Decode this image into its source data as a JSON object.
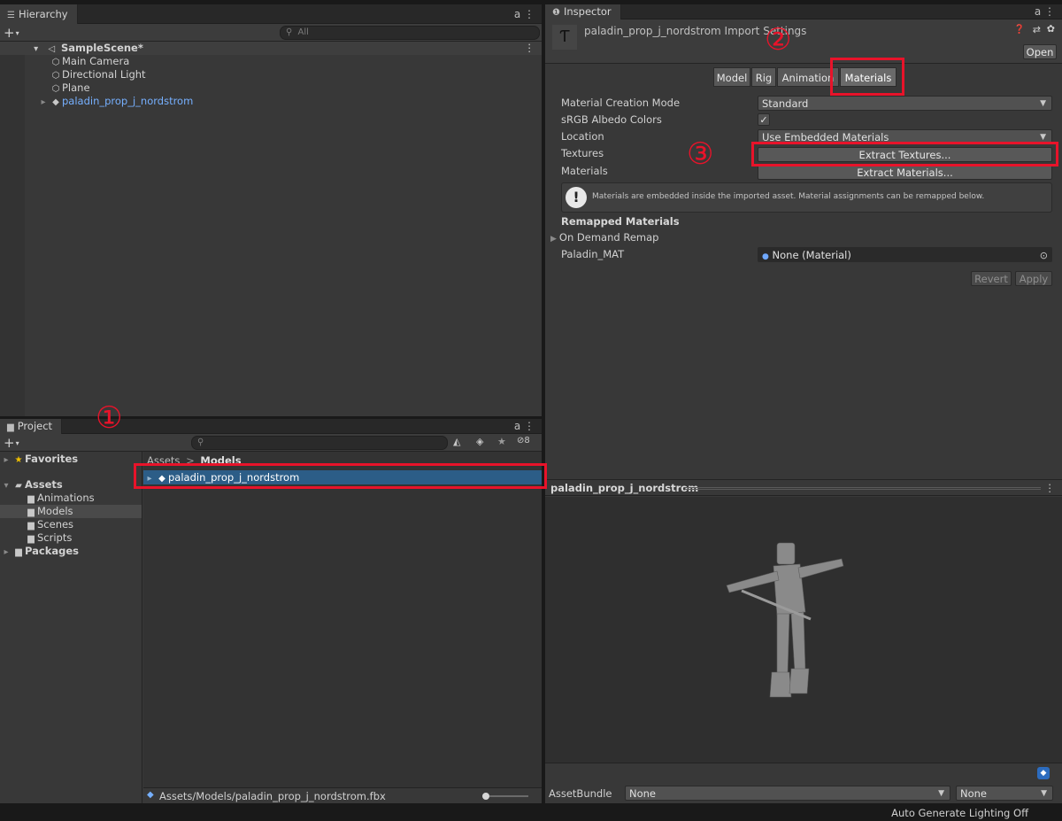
{
  "hierarchy": {
    "tab_label": "Hierarchy",
    "tab_controls": "a ⋮",
    "search_placeholder": "All",
    "scene_name": "SampleScene*",
    "items": [
      {
        "label": "Main Camera"
      },
      {
        "label": "Directional Light"
      },
      {
        "label": "Plane"
      },
      {
        "label": "paladin_prop_j_nordstrom"
      }
    ]
  },
  "project": {
    "tab_label": "Project",
    "tab_controls": "a ⋮",
    "hidden_count": "8",
    "tree": {
      "favorites": "Favorites",
      "assets": "Assets",
      "folders": [
        {
          "label": "Animations"
        },
        {
          "label": "Models"
        },
        {
          "label": "Scenes"
        },
        {
          "label": "Scripts"
        }
      ],
      "packages": "Packages"
    },
    "breadcrumb": {
      "root": "Assets",
      "separator": ">",
      "current": "Models"
    },
    "selected_asset": "paladin_prop_j_nordstrom",
    "footer_path": "Assets/Models/paladin_prop_j_nordstrom.fbx"
  },
  "inspector": {
    "tab_label": "Inspector",
    "tab_controls": "a ⋮",
    "title": "paladin_prop_j_nordstrom Import Settings",
    "open_label": "Open",
    "tabs": [
      {
        "label": "Model"
      },
      {
        "label": "Rig"
      },
      {
        "label": "Animation"
      },
      {
        "label": "Materials"
      }
    ],
    "active_tab": "Materials",
    "fields": {
      "material_creation_mode": {
        "label": "Material Creation Mode",
        "value": "Standard"
      },
      "srgb": {
        "label": "sRGB Albedo Colors",
        "checked": true
      },
      "location": {
        "label": "Location",
        "value": "Use Embedded Materials"
      },
      "textures": {
        "label": "Textures",
        "button": "Extract Textures..."
      },
      "materials": {
        "label": "Materials",
        "button": "Extract Materials..."
      }
    },
    "info_message": "Materials are embedded inside the imported asset. Material assignments can be remapped below.",
    "remapped_heading": "Remapped Materials",
    "on_demand_remap": "On Demand Remap",
    "paladin_mat": {
      "label": "Paladin_MAT",
      "value": "None (Material)"
    },
    "revert_label": "Revert",
    "apply_label": "Apply",
    "preview_title": "paladin_prop_j_nordstrom",
    "assetbundle": {
      "label": "AssetBundle",
      "name": "None",
      "variant": "None"
    }
  },
  "annotations": [
    "①",
    "②",
    "③"
  ],
  "status_bar": "Auto Generate Lighting Off",
  "colors": {
    "accent_red": "#e8132a",
    "selection_blue": "#2c5d87",
    "link_blue": "#76b0ff"
  }
}
